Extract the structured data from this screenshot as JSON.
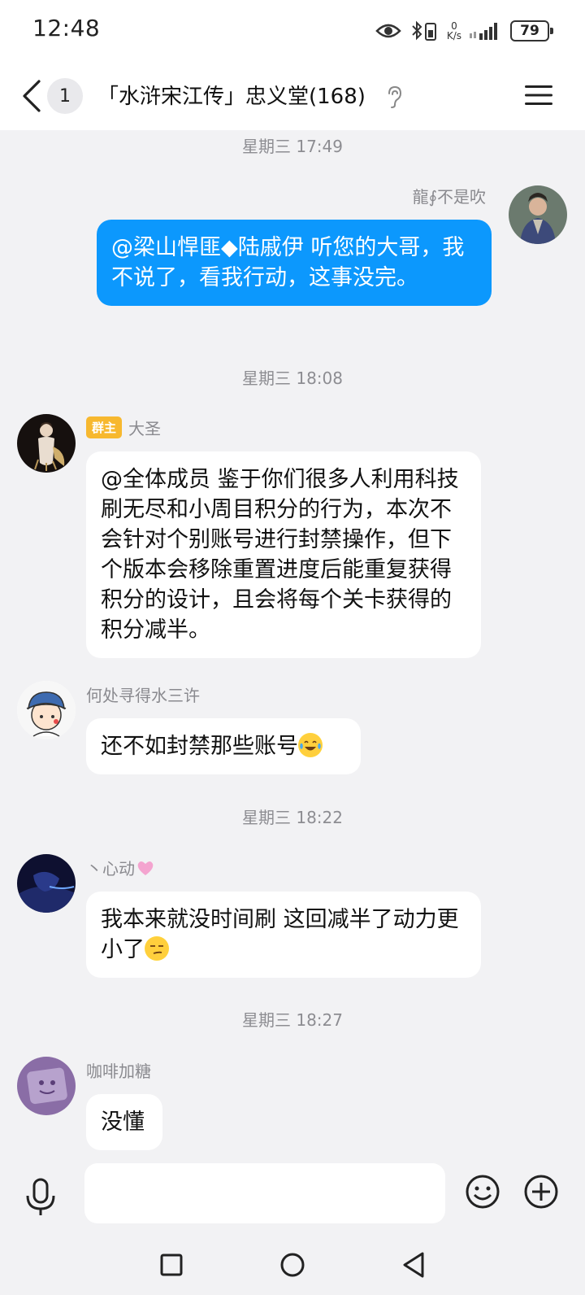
{
  "status_bar": {
    "time": "12:48",
    "net_speed_value": "0",
    "net_speed_unit": "K/s",
    "battery": "79"
  },
  "header": {
    "unread_count": "1",
    "title": "「水浒宋江传」忠义堂(168)"
  },
  "messages": [
    {
      "type": "timestamp",
      "text": "星期三 17:49"
    },
    {
      "type": "outgoing",
      "sender": "龍∮不是吹",
      "text": "@梁山悍匪◆陆戚伊 听您的大哥，我不说了，看我行动，这事没完。"
    },
    {
      "type": "timestamp",
      "text": "星期三 18:08"
    },
    {
      "type": "incoming",
      "role": "群主",
      "sender": "大圣",
      "text": "@全体成员 鉴于你们很多人利用科技刷无尽和小周目积分的行为，本次不会针对个别账号进行封禁操作，但下个版本会移除重置进度后能重复获得积分的设计，且会将每个关卡获得的积分减半。"
    },
    {
      "type": "incoming",
      "sender": "何处寻得水三许",
      "text": "还不如封禁那些账号",
      "emoji": "laughing-tears"
    },
    {
      "type": "timestamp",
      "text": "星期三 18:22"
    },
    {
      "type": "incoming",
      "sender": "丶心动",
      "sender_emoji": "pink-heart",
      "text": "我本来就没时间刷 这回减半了动力更小了",
      "emoji": "smirk"
    },
    {
      "type": "timestamp",
      "text": "星期三 18:27"
    },
    {
      "type": "incoming",
      "sender": "咖啡加糖",
      "text": "没懂"
    }
  ],
  "input": {
    "placeholder": ""
  },
  "colors": {
    "outgoing_bubble": "#0c98fd",
    "incoming_bubble": "#ffffff",
    "background": "#f2f2f4",
    "owner_badge": "#f7b82f"
  }
}
